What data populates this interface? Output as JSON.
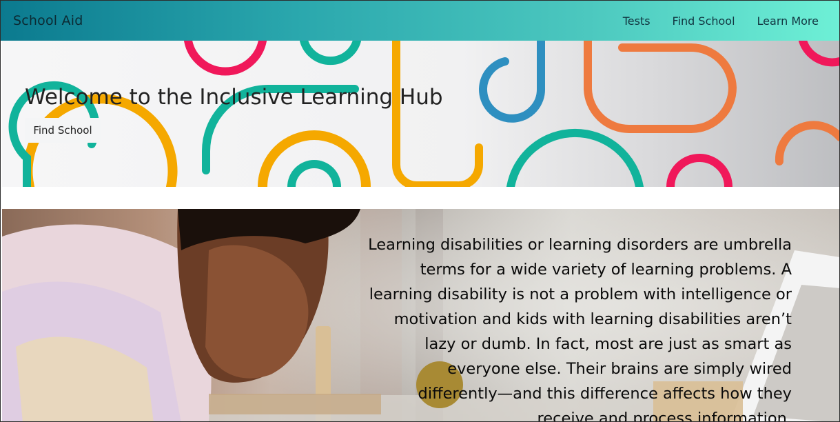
{
  "navbar": {
    "brand": "School Aid",
    "links": [
      "Tests",
      "Find School",
      "Learn More"
    ]
  },
  "hero": {
    "title": "Welcome to the Inclusive Learning Hub",
    "button": "Find School"
  },
  "info": {
    "text": "Learning disabilities or learning disorders are umbrella terms for a wide variety of learning problems. A learning disability is not a problem with intelligence or motivation and kids with learning disabilities aren’t lazy or dumb. In fact, most are just as smart as everyone else. Their brains are simply wired differently—and this difference affects how they receive and process information."
  },
  "colors": {
    "yellow": "#f5a800",
    "teal": "#11b39b",
    "pink": "#f0185a",
    "blue": "#2e8fc0",
    "orange": "#ee7a3f"
  }
}
